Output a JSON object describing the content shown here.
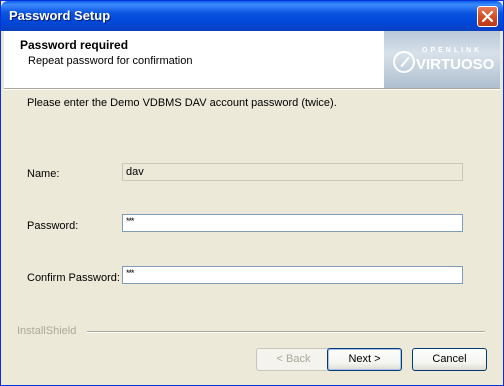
{
  "window": {
    "title": "Password Setup"
  },
  "header": {
    "title": "Password required",
    "subtitle": "Repeat password for confirmation",
    "logo": {
      "small_text": "OPENLINK",
      "big_text": "VIRTUOSO"
    }
  },
  "content": {
    "instruction": "Please enter the Demo VDBMS DAV account password (twice).",
    "name": {
      "label": "Name:",
      "value": "dav"
    },
    "password": {
      "label": "Password:",
      "value": "***"
    },
    "confirm": {
      "label": "Confirm Password:",
      "value": "***"
    }
  },
  "footer": {
    "brand": "InstallShield",
    "back_label": "< Back",
    "next_label": "Next >",
    "cancel_label": "Cancel"
  },
  "colors": {
    "titlebar": "#0054e3",
    "dialog_bg": "#ece9d8",
    "close_button": "#d04a22"
  }
}
